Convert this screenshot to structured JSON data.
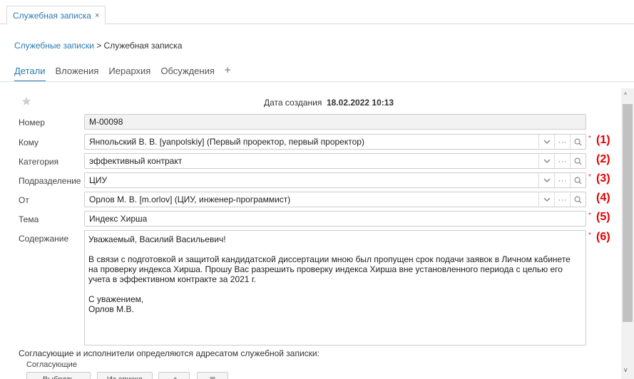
{
  "tab": {
    "title": "Служебная записка",
    "close": "×"
  },
  "breadcrumb": {
    "parent": "Служебные записки",
    "separator": ">",
    "current": "Служебная записка"
  },
  "subtabs": [
    "Детали",
    "Вложения",
    "Иерархия",
    "Обсуждения"
  ],
  "header": {
    "created_label": "Дата создания",
    "created_value": "18.02.2022 10:13"
  },
  "fields": [
    {
      "label": "Номер",
      "value": "M-00098"
    },
    {
      "label": "Кому",
      "value": "Янпольский В. В. [yanpolskiy] (Первый проректор, первый проректор)",
      "required": "*",
      "marker": "(1)"
    },
    {
      "label": "Категория",
      "value": "эффективный контракт",
      "marker": "(2)"
    },
    {
      "label": "Подразделение",
      "value": "ЦИУ",
      "required": "*",
      "marker": "(3)"
    },
    {
      "label": "От",
      "value": "Орлов М. В. [m.orlov] (ЦИУ, инженер-программист)",
      "marker": "(4)"
    },
    {
      "label": "Тема",
      "value": "Индекс Хирша",
      "required": "*",
      "marker": "(5)"
    }
  ],
  "content": {
    "label": "Содержание",
    "required": "*",
    "marker": "(6)",
    "greeting": "Уважаемый, Василий Васильевич!",
    "body": "В связи с подготовкой и защитой кандидатской диссертации мною был пропущен срок подачи заявок в Личном кабинете на проверку индекса Хирша. Прошу Вас разрешить проверку индекса Хирша вне установленного периода с целью его учета в эффективном контракте за 2021 г.",
    "closing": "С уважением,",
    "signature": "Орлов М.В."
  },
  "approval": {
    "note": "Согласующие и исполнители определяются адресатом служебной записки:",
    "approvers_label": "Согласующие"
  },
  "bottom_buttons": [
    "Выбрать",
    "Из списка"
  ],
  "colors": {
    "accent": "#2a7ab0",
    "required": "#e03030",
    "marker": "#e00000"
  }
}
